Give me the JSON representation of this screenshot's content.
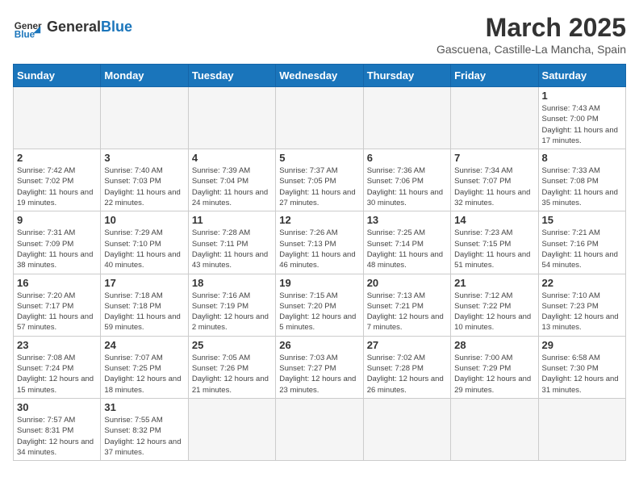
{
  "header": {
    "logo_general": "General",
    "logo_blue": "Blue",
    "month_title": "March 2025",
    "subtitle": "Gascuena, Castille-La Mancha, Spain"
  },
  "weekdays": [
    "Sunday",
    "Monday",
    "Tuesday",
    "Wednesday",
    "Thursday",
    "Friday",
    "Saturday"
  ],
  "weeks": [
    [
      {
        "day": "",
        "info": ""
      },
      {
        "day": "",
        "info": ""
      },
      {
        "day": "",
        "info": ""
      },
      {
        "day": "",
        "info": ""
      },
      {
        "day": "",
        "info": ""
      },
      {
        "day": "",
        "info": ""
      },
      {
        "day": "1",
        "info": "Sunrise: 7:43 AM\nSunset: 7:00 PM\nDaylight: 11 hours and 17 minutes."
      }
    ],
    [
      {
        "day": "2",
        "info": "Sunrise: 7:42 AM\nSunset: 7:02 PM\nDaylight: 11 hours and 19 minutes."
      },
      {
        "day": "3",
        "info": "Sunrise: 7:40 AM\nSunset: 7:03 PM\nDaylight: 11 hours and 22 minutes."
      },
      {
        "day": "4",
        "info": "Sunrise: 7:39 AM\nSunset: 7:04 PM\nDaylight: 11 hours and 24 minutes."
      },
      {
        "day": "5",
        "info": "Sunrise: 7:37 AM\nSunset: 7:05 PM\nDaylight: 11 hours and 27 minutes."
      },
      {
        "day": "6",
        "info": "Sunrise: 7:36 AM\nSunset: 7:06 PM\nDaylight: 11 hours and 30 minutes."
      },
      {
        "day": "7",
        "info": "Sunrise: 7:34 AM\nSunset: 7:07 PM\nDaylight: 11 hours and 32 minutes."
      },
      {
        "day": "8",
        "info": "Sunrise: 7:33 AM\nSunset: 7:08 PM\nDaylight: 11 hours and 35 minutes."
      }
    ],
    [
      {
        "day": "9",
        "info": "Sunrise: 7:31 AM\nSunset: 7:09 PM\nDaylight: 11 hours and 38 minutes."
      },
      {
        "day": "10",
        "info": "Sunrise: 7:29 AM\nSunset: 7:10 PM\nDaylight: 11 hours and 40 minutes."
      },
      {
        "day": "11",
        "info": "Sunrise: 7:28 AM\nSunset: 7:11 PM\nDaylight: 11 hours and 43 minutes."
      },
      {
        "day": "12",
        "info": "Sunrise: 7:26 AM\nSunset: 7:13 PM\nDaylight: 11 hours and 46 minutes."
      },
      {
        "day": "13",
        "info": "Sunrise: 7:25 AM\nSunset: 7:14 PM\nDaylight: 11 hours and 48 minutes."
      },
      {
        "day": "14",
        "info": "Sunrise: 7:23 AM\nSunset: 7:15 PM\nDaylight: 11 hours and 51 minutes."
      },
      {
        "day": "15",
        "info": "Sunrise: 7:21 AM\nSunset: 7:16 PM\nDaylight: 11 hours and 54 minutes."
      }
    ],
    [
      {
        "day": "16",
        "info": "Sunrise: 7:20 AM\nSunset: 7:17 PM\nDaylight: 11 hours and 57 minutes."
      },
      {
        "day": "17",
        "info": "Sunrise: 7:18 AM\nSunset: 7:18 PM\nDaylight: 11 hours and 59 minutes."
      },
      {
        "day": "18",
        "info": "Sunrise: 7:16 AM\nSunset: 7:19 PM\nDaylight: 12 hours and 2 minutes."
      },
      {
        "day": "19",
        "info": "Sunrise: 7:15 AM\nSunset: 7:20 PM\nDaylight: 12 hours and 5 minutes."
      },
      {
        "day": "20",
        "info": "Sunrise: 7:13 AM\nSunset: 7:21 PM\nDaylight: 12 hours and 7 minutes."
      },
      {
        "day": "21",
        "info": "Sunrise: 7:12 AM\nSunset: 7:22 PM\nDaylight: 12 hours and 10 minutes."
      },
      {
        "day": "22",
        "info": "Sunrise: 7:10 AM\nSunset: 7:23 PM\nDaylight: 12 hours and 13 minutes."
      }
    ],
    [
      {
        "day": "23",
        "info": "Sunrise: 7:08 AM\nSunset: 7:24 PM\nDaylight: 12 hours and 15 minutes."
      },
      {
        "day": "24",
        "info": "Sunrise: 7:07 AM\nSunset: 7:25 PM\nDaylight: 12 hours and 18 minutes."
      },
      {
        "day": "25",
        "info": "Sunrise: 7:05 AM\nSunset: 7:26 PM\nDaylight: 12 hours and 21 minutes."
      },
      {
        "day": "26",
        "info": "Sunrise: 7:03 AM\nSunset: 7:27 PM\nDaylight: 12 hours and 23 minutes."
      },
      {
        "day": "27",
        "info": "Sunrise: 7:02 AM\nSunset: 7:28 PM\nDaylight: 12 hours and 26 minutes."
      },
      {
        "day": "28",
        "info": "Sunrise: 7:00 AM\nSunset: 7:29 PM\nDaylight: 12 hours and 29 minutes."
      },
      {
        "day": "29",
        "info": "Sunrise: 6:58 AM\nSunset: 7:30 PM\nDaylight: 12 hours and 31 minutes."
      }
    ],
    [
      {
        "day": "30",
        "info": "Sunrise: 7:57 AM\nSunset: 8:31 PM\nDaylight: 12 hours and 34 minutes."
      },
      {
        "day": "31",
        "info": "Sunrise: 7:55 AM\nSunset: 8:32 PM\nDaylight: 12 hours and 37 minutes."
      },
      {
        "day": "",
        "info": ""
      },
      {
        "day": "",
        "info": ""
      },
      {
        "day": "",
        "info": ""
      },
      {
        "day": "",
        "info": ""
      },
      {
        "day": "",
        "info": ""
      }
    ]
  ]
}
